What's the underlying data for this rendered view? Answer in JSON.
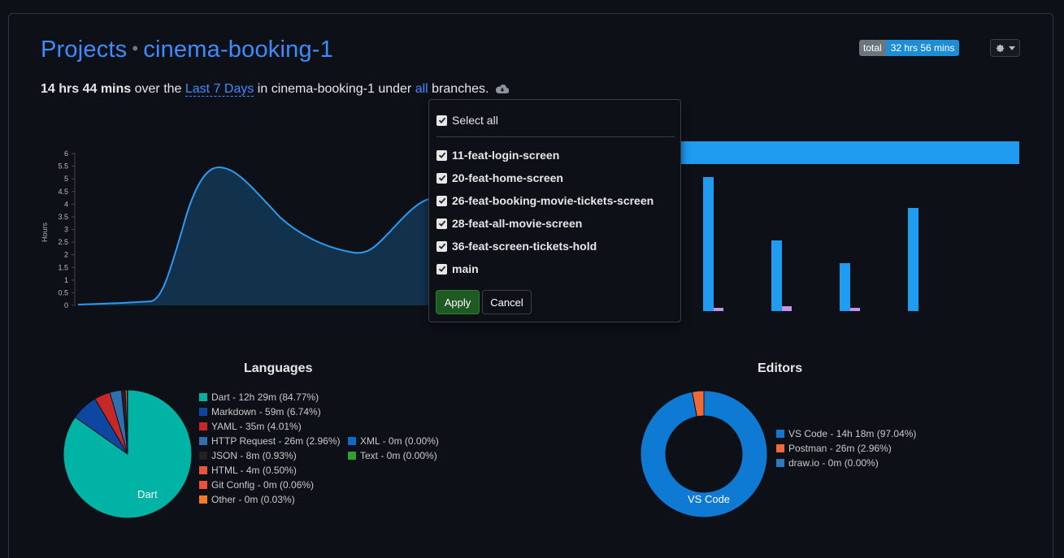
{
  "header": {
    "title_prefix": "Projects",
    "separator": "•",
    "project_name": "cinema-booking-1",
    "total_label": "total",
    "total_value": "32 hrs 56 mins"
  },
  "summary": {
    "time": "14 hrs 44 mins",
    "over_text": " over the ",
    "range_link": "Last 7 Days",
    "in_text": " in cinema-booking-1 under ",
    "branches_link": "all",
    "branches_text": " branches."
  },
  "chart_data": {
    "type": "area",
    "ylabel": "Hours",
    "ylim": [
      0,
      6
    ],
    "yticks": [
      "6",
      "5.5",
      "5",
      "4.5",
      "4",
      "3.5",
      "3",
      "2.5",
      "2",
      "1.5",
      "1",
      "0.5",
      "0"
    ],
    "values_visible": [
      0.02,
      0.1,
      5.5,
      3.2,
      2.1,
      4.2
    ]
  },
  "branch_dropdown": {
    "select_all_label": "Select all",
    "branches": [
      "11-feat-login-screen",
      "20-feat-home-screen",
      "26-feat-booking-movie-tickets-screen",
      "28-feat-all-movie-screen",
      "36-feat-screen-tickets-hold",
      "main"
    ],
    "apply_label": "Apply",
    "cancel_label": "Cancel"
  },
  "languages": {
    "title": "Languages",
    "pie_label": "Dart",
    "items": [
      {
        "label": "Dart - 12h 29m (84.77%)",
        "color": "#00b3a4",
        "pct": 84.77
      },
      {
        "label": "Markdown - 59m (6.74%)",
        "color": "#0d47a1",
        "pct": 6.74
      },
      {
        "label": "YAML - 35m (4.01%)",
        "color": "#c62828",
        "pct": 4.01
      },
      {
        "label": "HTTP Request - 26m (2.96%)",
        "color": "#2f6fb0",
        "pct": 2.96
      },
      {
        "label": "JSON - 8m (0.93%)",
        "color": "#222222",
        "pct": 0.93
      },
      {
        "label": "HTML - 4m (0.50%)",
        "color": "#e8553a",
        "pct": 0.5
      },
      {
        "label": "Git Config - 0m (0.06%)",
        "color": "#f05033",
        "pct": 0.06
      },
      {
        "label": "Other - 0m (0.03%)",
        "color": "#f57c20",
        "pct": 0.03
      },
      {
        "label": "XML - 0m (0.00%)",
        "color": "#0b6bcb",
        "pct": 0
      },
      {
        "label": "Text - 0m (0.00%)",
        "color": "#2ea02e",
        "pct": 0
      }
    ]
  },
  "editors": {
    "title": "Editors",
    "donut_label": "VS Code",
    "items": [
      {
        "label": "VS Code - 14h 18m (97.04%)",
        "color": "#0f7ad4",
        "pct": 97.04
      },
      {
        "label": "Postman - 26m (2.96%)",
        "color": "#ef6a38",
        "pct": 2.96
      },
      {
        "label": "draw.io - 0m (0.00%)",
        "color": "#2e78c2",
        "pct": 0
      }
    ]
  },
  "colors": {
    "accent": "#3d8bfd",
    "bar_blue": "#1f9bf0",
    "bar_purple": "#c792ea"
  }
}
